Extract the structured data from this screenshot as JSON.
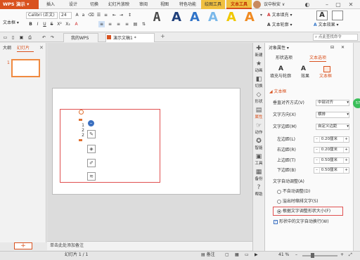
{
  "app": {
    "name": "WPS 演示",
    "user": "议中秋安 ∨"
  },
  "menu": {
    "items": [
      "插入",
      "设计",
      "切换",
      "幻灯片放映",
      "审阅",
      "视图",
      "特色功能"
    ],
    "context_tabs": [
      "绘图工具",
      "文本工具"
    ]
  },
  "ribbon": {
    "style_label": "文本框",
    "font_name": "Calibri (正文)",
    "font_size": "24",
    "format_buttons": [
      "B",
      "I",
      "U",
      "S",
      "X²",
      "X₂",
      "A"
    ],
    "big_styles": [
      "A",
      "A",
      "A",
      "A",
      "A",
      "A"
    ],
    "text_fill": "文本填充",
    "text_outline": "文本轮廓",
    "text_effects": "文本效果",
    "shape_fill_label": "A"
  },
  "tabs": {
    "home": "我的WPS",
    "doc": "演示文稿1 *",
    "search_placeholder": "点此查找命令"
  },
  "left_panel": {
    "tabs": [
      "大纲",
      "幻灯片"
    ],
    "slide_number": "1",
    "add_button": "+"
  },
  "canvas": {
    "text_lines": [
      "1",
      "2",
      "2"
    ],
    "notes_placeholder": "单击此处添加备注"
  },
  "side_strip": {
    "items": [
      "新建",
      "动画",
      "切换",
      "形状",
      "属性",
      "动作",
      "智能",
      "工具",
      "备份",
      "帮助"
    ]
  },
  "props": {
    "header": "对象属性 ▾",
    "top_tabs": [
      "形状选项",
      "文本选项"
    ],
    "sub_tabs": [
      "填充与轮廓",
      "效果",
      "文本框"
    ],
    "section_title": "文本框",
    "vertical_align_label": "垂直对齐方式(V)",
    "vertical_align_value": "中部对齐",
    "text_direction_label": "文字方向(X)",
    "text_direction_value": "横排",
    "margins_label": "文字边距(M)",
    "margins_value": "自定义边距",
    "left_margin_label": "左边距(L)",
    "left_margin_value": "0.20厘米",
    "right_margin_label": "右边距(R)",
    "right_margin_value": "0.20厘米",
    "top_margin_label": "上边距(T)",
    "top_margin_value": "0.50厘米",
    "bottom_margin_label": "下边距(B)",
    "bottom_margin_value": "0.50厘米",
    "autofit_label": "文字自动调整(A)",
    "autofit_options": [
      "不自动调整(D)",
      "溢出时缩排文字(S)",
      "根据文字调整形状大小(F)"
    ],
    "autofit_selected": 2,
    "wrap_label": "形状中的文字自动换行(W)",
    "wrap_checked": true
  },
  "status": {
    "slide_info": "幻灯片 1 / 1",
    "notes": "备注",
    "zoom": "41 %"
  },
  "badge": {
    "text": "57"
  }
}
